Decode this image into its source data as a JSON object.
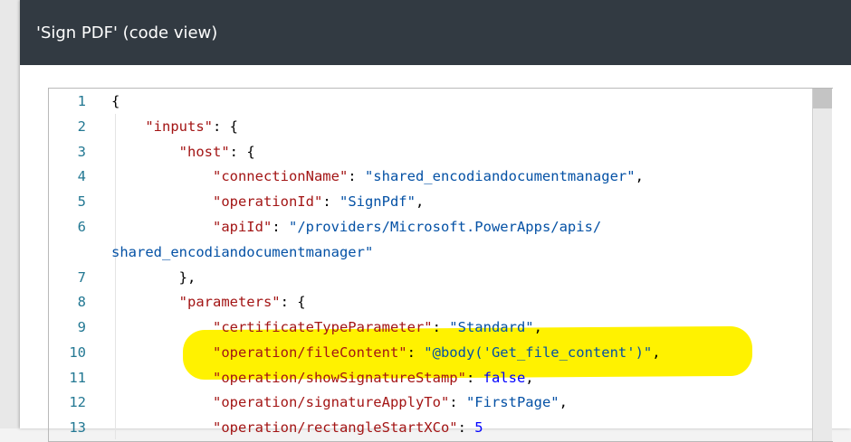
{
  "window": {
    "title": "'Sign PDF' (code view)"
  },
  "editor": {
    "lines": [
      {
        "num": "1",
        "parts": [
          {
            "t": "{",
            "c": "p"
          }
        ]
      },
      {
        "num": "2",
        "parts": [
          {
            "t": "    ",
            "c": "p"
          },
          {
            "t": "\"inputs\"",
            "c": "k"
          },
          {
            "t": ": {",
            "c": "p"
          }
        ]
      },
      {
        "num": "3",
        "parts": [
          {
            "t": "        ",
            "c": "p"
          },
          {
            "t": "\"host\"",
            "c": "k"
          },
          {
            "t": ": {",
            "c": "p"
          }
        ]
      },
      {
        "num": "4",
        "parts": [
          {
            "t": "            ",
            "c": "p"
          },
          {
            "t": "\"connectionName\"",
            "c": "k"
          },
          {
            "t": ": ",
            "c": "p"
          },
          {
            "t": "\"shared_encodiandocumentmanager\"",
            "c": "s"
          },
          {
            "t": ",",
            "c": "p"
          }
        ]
      },
      {
        "num": "5",
        "parts": [
          {
            "t": "            ",
            "c": "p"
          },
          {
            "t": "\"operationId\"",
            "c": "k"
          },
          {
            "t": ": ",
            "c": "p"
          },
          {
            "t": "\"SignPdf\"",
            "c": "s"
          },
          {
            "t": ",",
            "c": "p"
          }
        ]
      },
      {
        "num": "6",
        "parts": [
          {
            "t": "            ",
            "c": "p"
          },
          {
            "t": "\"apiId\"",
            "c": "k"
          },
          {
            "t": ": ",
            "c": "p"
          },
          {
            "t": "\"/providers/Microsoft.PowerApps/apis/",
            "c": "s"
          }
        ]
      },
      {
        "num": "",
        "parts": [
          {
            "t": "shared_encodiandocumentmanager\"",
            "c": "s"
          }
        ]
      },
      {
        "num": "7",
        "parts": [
          {
            "t": "        },",
            "c": "p"
          }
        ]
      },
      {
        "num": "8",
        "parts": [
          {
            "t": "        ",
            "c": "p"
          },
          {
            "t": "\"parameters\"",
            "c": "k"
          },
          {
            "t": ": {",
            "c": "p"
          }
        ]
      },
      {
        "num": "9",
        "parts": [
          {
            "t": "            ",
            "c": "p"
          },
          {
            "t": "\"certificateTypeParameter\"",
            "c": "k"
          },
          {
            "t": ": ",
            "c": "p"
          },
          {
            "t": "\"Standard\"",
            "c": "s"
          },
          {
            "t": ",",
            "c": "p"
          }
        ]
      },
      {
        "num": "10",
        "parts": [
          {
            "t": "            ",
            "c": "p"
          },
          {
            "t": "\"operation/fileContent\"",
            "c": "k"
          },
          {
            "t": ": ",
            "c": "p"
          },
          {
            "t": "\"@body('Get_file_content')\"",
            "c": "s"
          },
          {
            "t": ",",
            "c": "p"
          }
        ]
      },
      {
        "num": "11",
        "parts": [
          {
            "t": "            ",
            "c": "p"
          },
          {
            "t": "\"operation/showSignatureStamp\"",
            "c": "k"
          },
          {
            "t": ": ",
            "c": "p"
          },
          {
            "t": "false",
            "c": "b"
          },
          {
            "t": ",",
            "c": "p"
          }
        ]
      },
      {
        "num": "12",
        "parts": [
          {
            "t": "            ",
            "c": "p"
          },
          {
            "t": "\"operation/signatureApplyTo\"",
            "c": "k"
          },
          {
            "t": ": ",
            "c": "p"
          },
          {
            "t": "\"FirstPage\"",
            "c": "s"
          },
          {
            "t": ",",
            "c": "p"
          }
        ]
      },
      {
        "num": "13",
        "parts": [
          {
            "t": "            ",
            "c": "p"
          },
          {
            "t": "\"operation/rectangleStartXCo\"",
            "c": "k"
          },
          {
            "t": ": ",
            "c": "p"
          },
          {
            "t": "5",
            "c": "b"
          }
        ]
      }
    ]
  },
  "colors": {
    "titlebar": "#323a42",
    "key": "#a31515",
    "string": "#0451a5",
    "keyword": "#0000ff",
    "line_number": "#237893",
    "highlight": "#fff200"
  }
}
